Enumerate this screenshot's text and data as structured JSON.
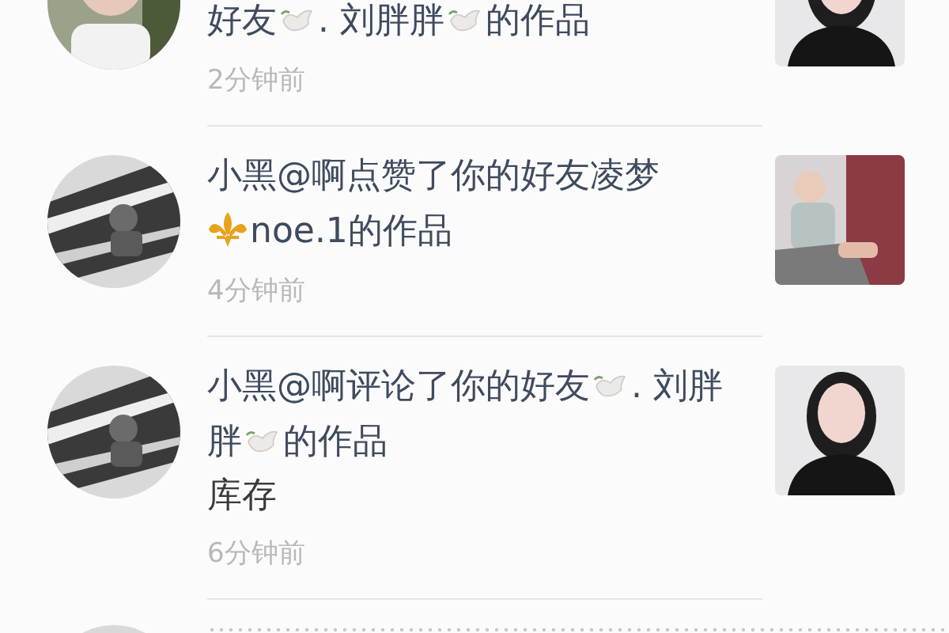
{
  "notifications": [
    {
      "kind": "item",
      "avatar": {
        "kind": "picture"
      },
      "lines": [
        [
          {
            "kind": "text",
            "text": "好友"
          },
          {
            "kind": "dove"
          },
          {
            "kind": "text",
            "text": ". 刘胖胖"
          },
          {
            "kind": "dove"
          },
          {
            "kind": "text",
            "text": "的作品"
          }
        ]
      ],
      "time": "2分钟前",
      "thumbnail": {
        "kind": "picture"
      }
    },
    {
      "kind": "item",
      "avatar": {
        "kind": "picture"
      },
      "lines": [
        [
          {
            "kind": "text",
            "text": "小黑@啊点赞了你的好友凌梦"
          }
        ],
        [
          {
            "kind": "fleur"
          },
          {
            "kind": "text",
            "text": "noe.1的作品"
          }
        ]
      ],
      "time": "4分钟前",
      "thumbnail": {
        "kind": "picture"
      }
    },
    {
      "kind": "item",
      "avatar": {
        "kind": "picture"
      },
      "lines": [
        [
          {
            "kind": "text",
            "text": "小黑@啊评论了你的好友"
          },
          {
            "kind": "dove"
          },
          {
            "kind": "text",
            "text": ". 刘胖"
          }
        ],
        [
          {
            "kind": "text",
            "text": "胖"
          },
          {
            "kind": "dove"
          },
          {
            "kind": "text",
            "text": "的作品"
          }
        ]
      ],
      "comment": "库存",
      "time": "6分钟前",
      "thumbnail": {
        "kind": "picture"
      }
    },
    {
      "kind": "loading",
      "avatar": {
        "kind": "picture"
      }
    }
  ]
}
